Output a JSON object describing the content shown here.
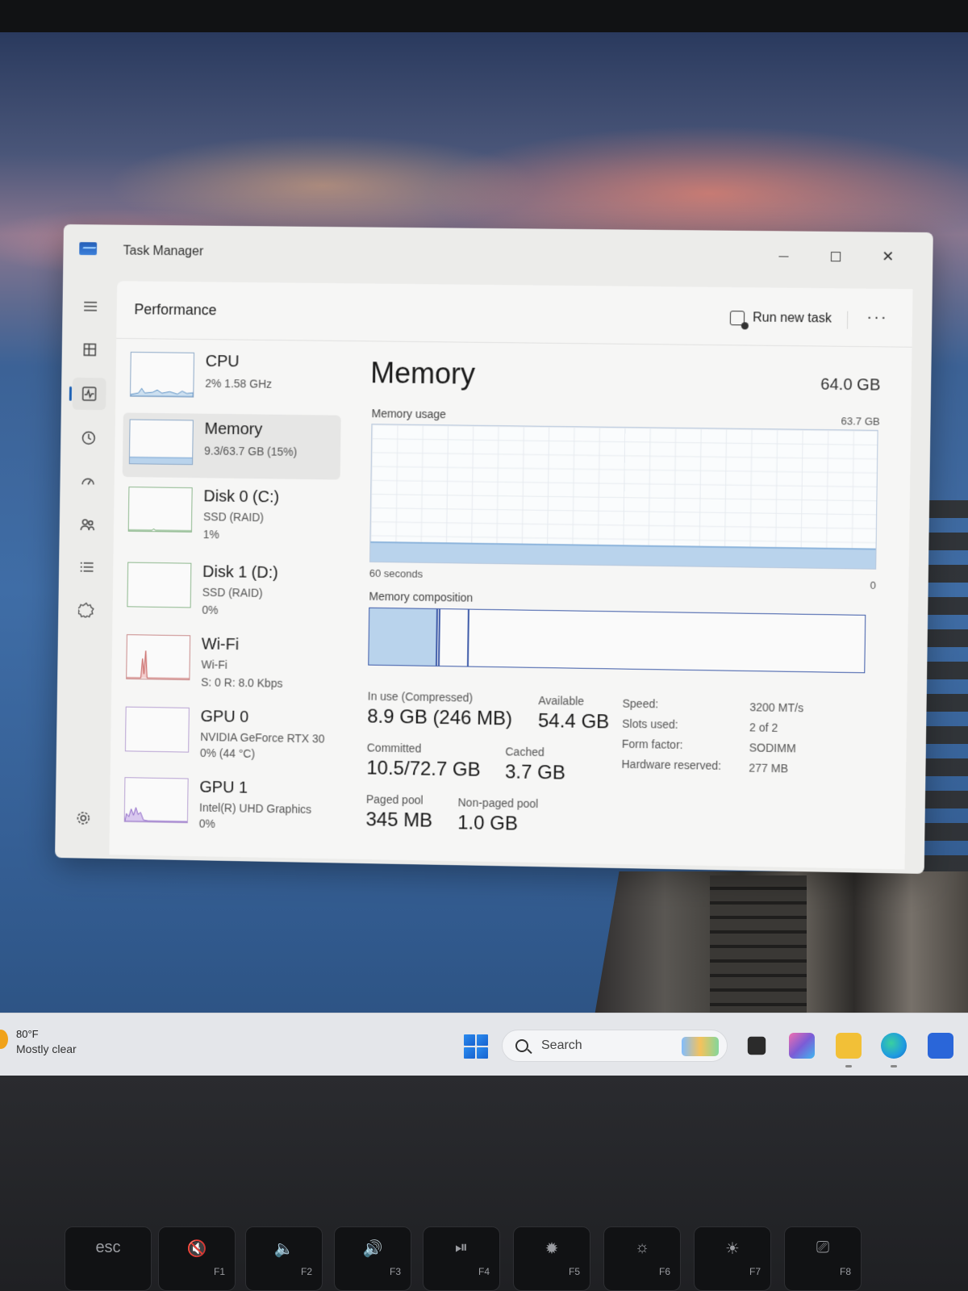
{
  "window": {
    "title": "Task Manager",
    "minimize_label": "",
    "page_title": "Performance",
    "run_new_task": "Run new task",
    "more": "···"
  },
  "nav": {
    "items": [
      {
        "icon": "hamburger-menu-icon"
      },
      {
        "icon": "processes-icon"
      },
      {
        "icon": "performance-icon",
        "active": true
      },
      {
        "icon": "app-history-icon"
      },
      {
        "icon": "startup-apps-icon"
      },
      {
        "icon": "users-icon"
      },
      {
        "icon": "details-icon"
      },
      {
        "icon": "services-icon"
      },
      {
        "icon": "settings-icon"
      }
    ]
  },
  "resources": [
    {
      "name": "CPU",
      "line1": "2%  1.58 GHz",
      "line2": ""
    },
    {
      "name": "Memory",
      "line1": "9.3/63.7 GB (15%)",
      "line2": "",
      "selected": true
    },
    {
      "name": "Disk 0 (C:)",
      "line1": "SSD (RAID)",
      "line2": "1%"
    },
    {
      "name": "Disk 1 (D:)",
      "line1": "SSD (RAID)",
      "line2": "0%"
    },
    {
      "name": "Wi-Fi",
      "line1": "Wi-Fi",
      "line2": "S: 0  R: 8.0 Kbps"
    },
    {
      "name": "GPU 0",
      "line1": "NVIDIA GeForce RTX 30",
      "line2": "0%  (44 °C)"
    },
    {
      "name": "GPU 1",
      "line1": "Intel(R) UHD Graphics",
      "line2": "0%"
    }
  ],
  "memory": {
    "title": "Memory",
    "total": "64.0 GB",
    "usage_label": "Memory usage",
    "usage_max": "63.7 GB",
    "usage_fraction": 0.15,
    "time_label": "60 seconds",
    "zero_label": "0",
    "composition_label": "Memory composition",
    "composition": {
      "in_use_gb": 8.9,
      "modified_gb": 0.2,
      "standby_gb": 3.7,
      "total_gb": 63.7
    },
    "stats": {
      "in_use_label": "In use (Compressed)",
      "in_use_value": "8.9 GB (246 MB)",
      "available_label": "Available",
      "available_value": "54.4 GB",
      "committed_label": "Committed",
      "committed_value": "10.5/72.7 GB",
      "cached_label": "Cached",
      "cached_value": "3.7 GB",
      "paged_label": "Paged pool",
      "paged_value": "345 MB",
      "nonpaged_label": "Non-paged pool",
      "nonpaged_value": "1.0 GB"
    },
    "specs": [
      {
        "label": "Speed:",
        "value": "3200 MT/s"
      },
      {
        "label": "Slots used:",
        "value": "2 of 2"
      },
      {
        "label": "Form factor:",
        "value": "SODIMM"
      },
      {
        "label": "Hardware reserved:",
        "value": "277 MB"
      }
    ]
  },
  "taskbar": {
    "weather_temp": "80°F",
    "weather_desc": "Mostly clear",
    "search_placeholder": "Search",
    "apps": [
      {
        "icon": "task-view-icon",
        "color": "#2b2b2b"
      },
      {
        "icon": "m365-copilot-icon",
        "color": "#7b5cd6"
      },
      {
        "icon": "file-explorer-icon",
        "color": "#f2c037"
      },
      {
        "icon": "edge-icon",
        "color": "#1f9be0"
      },
      {
        "icon": "microsoft-store-icon",
        "color": "#2a66d9"
      }
    ]
  },
  "keyboard": {
    "keys": [
      {
        "main": "esc",
        "fn": ""
      },
      {
        "main": "🔇",
        "fn": "F1"
      },
      {
        "main": "🔈",
        "fn": "F2"
      },
      {
        "main": "🔊",
        "fn": "F3"
      },
      {
        "main": "⏯",
        "fn": "F4"
      },
      {
        "main": "✹",
        "fn": "F5"
      },
      {
        "main": "☼",
        "fn": "F6"
      },
      {
        "main": "☀",
        "fn": "F7"
      },
      {
        "main": "⎚",
        "fn": "F8"
      }
    ]
  }
}
